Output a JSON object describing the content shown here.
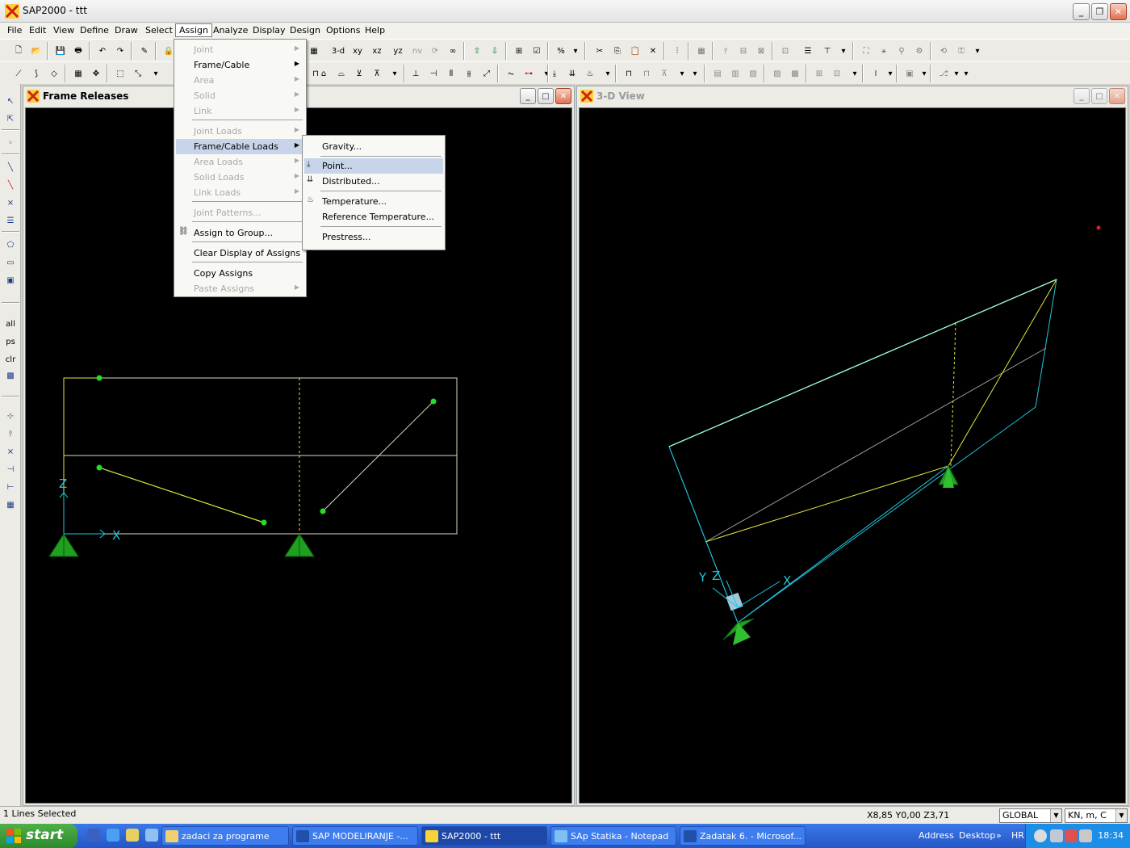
{
  "window": {
    "title": "SAP2000 - ttt"
  },
  "menubar": [
    "File",
    "Edit",
    "View",
    "Define",
    "Draw",
    "Select",
    "Assign",
    "Analyze",
    "Display",
    "Design",
    "Options",
    "Help"
  ],
  "toolbar": {
    "view_3d": "3-d",
    "view_xy": "xy",
    "view_xz": "xz",
    "view_yz": "yz",
    "view_nv": "nv"
  },
  "left_toolbar": {
    "all": "all",
    "ps": "ps",
    "clr": "clr"
  },
  "assign_menu": {
    "items": [
      {
        "label": "Joint",
        "disabled": true,
        "submenu": true
      },
      {
        "label": "Frame/Cable",
        "disabled": false,
        "submenu": true
      },
      {
        "label": "Area",
        "disabled": true,
        "submenu": true
      },
      {
        "label": "Solid",
        "disabled": true,
        "submenu": true
      },
      {
        "label": "Link",
        "disabled": true,
        "submenu": true
      },
      {
        "label": "Joint Loads",
        "disabled": true,
        "submenu": true
      },
      {
        "label": "Frame/Cable Loads",
        "disabled": false,
        "submenu": true,
        "highlighted": true
      },
      {
        "label": "Area Loads",
        "disabled": true,
        "submenu": true
      },
      {
        "label": "Solid Loads",
        "disabled": true,
        "submenu": true
      },
      {
        "label": "Link Loads",
        "disabled": true,
        "submenu": true
      },
      {
        "label": "Joint Patterns...",
        "disabled": true
      },
      {
        "label": "Assign to Group...",
        "disabled": false
      },
      {
        "label": "Clear Display of Assigns",
        "disabled": false
      },
      {
        "label": "Copy Assigns",
        "disabled": false
      },
      {
        "label": "Paste Assigns",
        "disabled": true,
        "submenu": true
      }
    ]
  },
  "frame_loads_submenu": {
    "items": [
      {
        "label": "Gravity..."
      },
      {
        "label": "Point...",
        "highlighted": true
      },
      {
        "label": "Distributed..."
      },
      {
        "label": "Temperature..."
      },
      {
        "label": "Reference Temperature..."
      },
      {
        "label": "Prestress..."
      }
    ]
  },
  "left_window": {
    "title": "Frame Releases",
    "axis_x": "X",
    "axis_z": "Z"
  },
  "right_window": {
    "title": "3-D View",
    "axis_x": "X",
    "axis_y": "Y",
    "axis_z": "Z"
  },
  "model_colors": {
    "frame": "#e6e640",
    "grid": "#d8d8c0",
    "axis": "#20c8e0",
    "support": "#20a020",
    "joint": "#20e020"
  },
  "statusbar": {
    "selection": "1 Lines Selected",
    "coords": "X8,85  Y0,00  Z3,71",
    "coord_system": "GLOBAL",
    "units": "KN, m, C"
  },
  "taskbar": {
    "start": "start",
    "tasks": [
      "zadaci za programe",
      "SAP  MODELIRANJE -...",
      "SAP2000 - ttt",
      "SAp Statika - Notepad",
      "Zadatak 6. - Microsof..."
    ],
    "address": "Address",
    "desktop": "Desktop",
    "lang": "HR",
    "time": "18:34"
  }
}
